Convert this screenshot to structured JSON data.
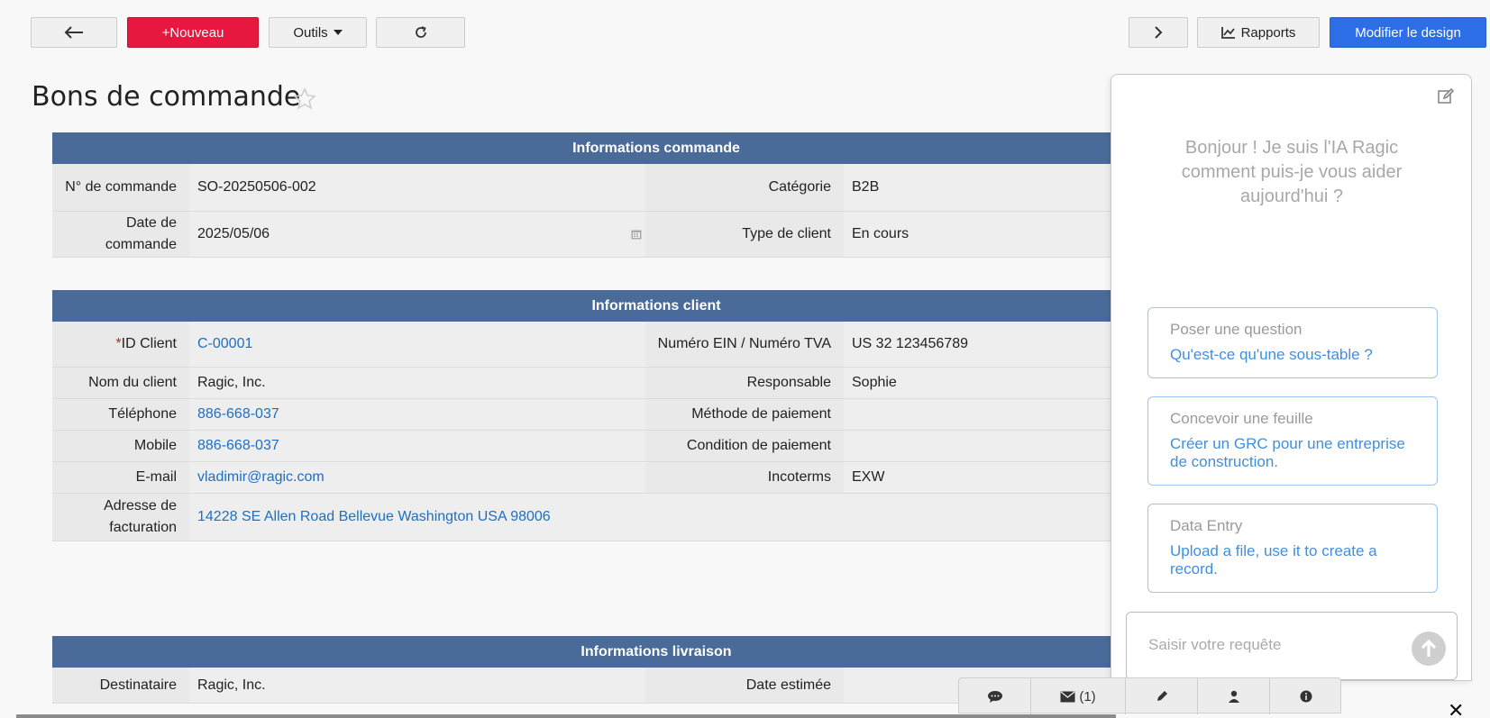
{
  "toolbar": {
    "new_label": "+Nouveau",
    "tools_label": "Outils",
    "reports_label": "Rapports",
    "design_label": "Modifier le design"
  },
  "page": {
    "title": "Bons de commande"
  },
  "sections": {
    "order": {
      "title": "Informations commande",
      "order_no_label": "N° de commande",
      "order_no": "SO-20250506-002",
      "category_label": "Catégorie",
      "category": "B2B",
      "date_label": "Date de commande",
      "date": "2025/05/06",
      "client_type_label": "Type de client",
      "client_type": "En cours"
    },
    "client": {
      "title": "Informations client",
      "required_mark": "*",
      "id_label": "ID Client",
      "id": "C-00001",
      "ein_label": "Numéro EIN / Numéro TVA",
      "ein": "US 32 123456789",
      "name_label": "Nom du client",
      "name": "Ragic, Inc.",
      "owner_label": "Responsable",
      "owner": "Sophie",
      "phone_label": "Téléphone",
      "phone": "886-668-037",
      "payment_method_label": "Méthode de paiement",
      "payment_method": "",
      "mobile_label": "Mobile",
      "mobile": "886-668-037",
      "payment_terms_label": "Condition de paiement",
      "payment_terms": "",
      "email_label": "E-mail",
      "email": "vladimir@ragic.com",
      "incoterms_label": "Incoterms",
      "incoterms": "EXW",
      "billing_label": "Adresse de facturation",
      "billing": "14228 SE Allen Road Bellevue Washington USA 98006"
    },
    "delivery": {
      "title": "Informations livraison",
      "recipient_label": "Destinataire",
      "recipient": "Ragic, Inc.",
      "estimated_date_label": "Date estimée",
      "estimated_date": ""
    }
  },
  "ai": {
    "greeting": "Bonjour ! Je suis l'IA Ragic comment puis-je vous aider aujourd'hui ?",
    "cards": [
      {
        "title": "Poser une question",
        "text": "Qu'est-ce qu'une sous-table ?"
      },
      {
        "title": "Concevoir une feuille",
        "text": "Créer un GRC pour une entreprise de construction."
      },
      {
        "title": "Data Entry",
        "text": "Upload a file, use it to create a record."
      }
    ],
    "input_placeholder": "Saisir votre requête"
  },
  "bottom_bar": {
    "mail_count": "(1)"
  },
  "colors": {
    "section_header": "#4a6b9a",
    "new_button": "#e8173f",
    "design_button": "#2d6de6",
    "link": "#1e6fc2"
  }
}
